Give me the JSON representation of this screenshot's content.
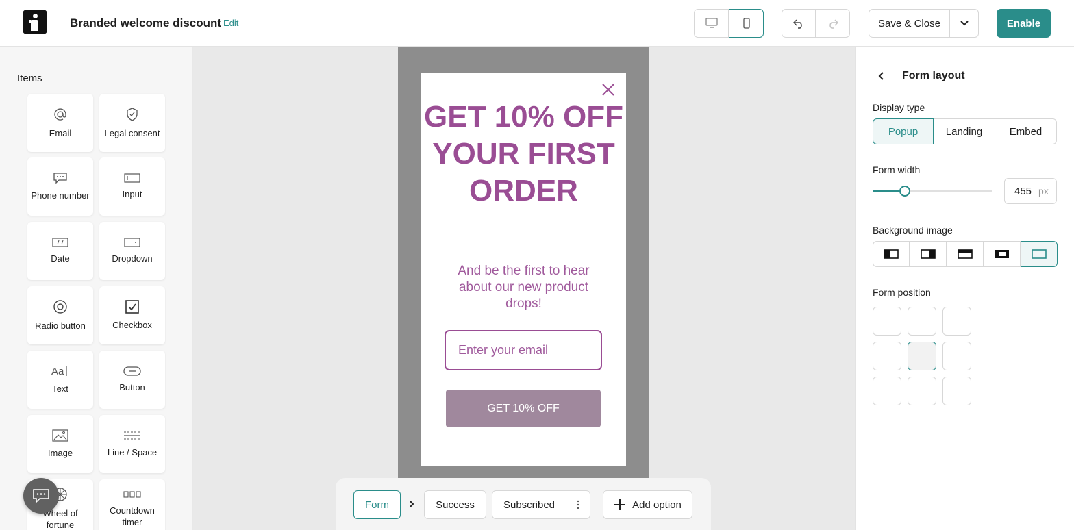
{
  "header": {
    "title": "Branded welcome discount",
    "edit_label": "Edit",
    "save_label": "Save & Close",
    "enable_label": "Enable"
  },
  "sidebar": {
    "title": "Items",
    "items": [
      {
        "label": "Email",
        "icon": "at-icon"
      },
      {
        "label": "Legal consent",
        "icon": "shield-check-icon"
      },
      {
        "label": "Phone number",
        "icon": "chat-dots-icon"
      },
      {
        "label": "Input",
        "icon": "input-field-icon"
      },
      {
        "label": "Date",
        "icon": "date-field-icon"
      },
      {
        "label": "Dropdown",
        "icon": "dropdown-field-icon"
      },
      {
        "label": "Radio button",
        "icon": "radio-icon"
      },
      {
        "label": "Checkbox",
        "icon": "checkbox-icon"
      },
      {
        "label": "Text",
        "icon": "text-icon"
      },
      {
        "label": "Button",
        "icon": "button-icon"
      },
      {
        "label": "Image",
        "icon": "image-icon"
      },
      {
        "label": "Line / Space",
        "icon": "line-space-icon"
      },
      {
        "label": "Wheel of fortune",
        "icon": "wheel-icon"
      },
      {
        "label": "Countdown timer",
        "icon": "countdown-icon"
      }
    ]
  },
  "popup": {
    "headline": "GET 10% OFF YOUR FIRST ORDER",
    "subtext": "And be the first to hear about our new product drops!",
    "email_placeholder": "Enter your email",
    "cta_label": "GET 10% OFF"
  },
  "steps": {
    "form": "Form",
    "success": "Success",
    "subscribed": "Subscribed",
    "add_option": "Add option"
  },
  "panel": {
    "title": "Form layout",
    "display_type_label": "Display type",
    "display_types": [
      "Popup",
      "Landing",
      "Embed"
    ],
    "display_type_selected": "Popup",
    "form_width_label": "Form width",
    "form_width_value": "455",
    "form_width_unit": "px",
    "form_width_slider_fraction": 0.27,
    "background_image_label": "Background image",
    "background_image_selected": 5,
    "form_position_label": "Form position",
    "form_position_selected": "middle-center"
  },
  "colors": {
    "accent": "#2a8d8a",
    "popup_text": "#9a4d94",
    "cta_bg": "#a0889d",
    "phone_frame": "#8d8d8d"
  }
}
